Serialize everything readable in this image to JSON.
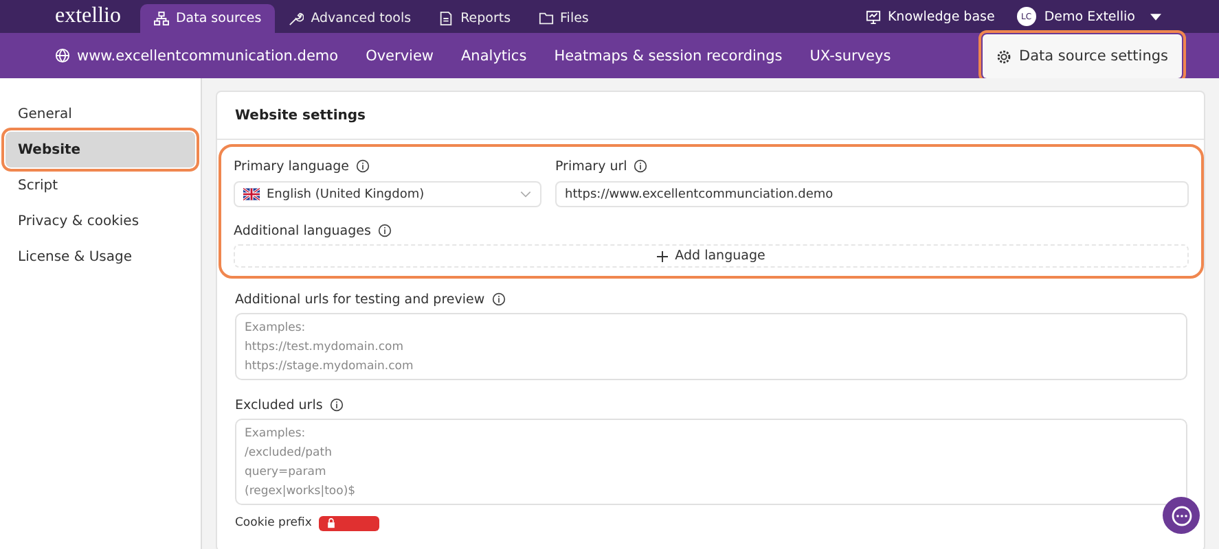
{
  "top_bar": {
    "logo": "extellio",
    "tabs": [
      {
        "label": "Data sources",
        "kind": "sitemap",
        "selected": true
      },
      {
        "label": "Advanced tools",
        "kind": "wrench",
        "selected": false
      },
      {
        "label": "Reports",
        "kind": "doc",
        "selected": false
      },
      {
        "label": "Files",
        "kind": "folder",
        "selected": false
      }
    ],
    "knowledge_base": "Knowledge base",
    "user": {
      "initials": "LC",
      "name": "Demo Extellio"
    }
  },
  "sub_bar": {
    "site": "www.excellentcommunication.demo",
    "links": [
      "Overview",
      "Analytics",
      "Heatmaps & session recordings",
      "UX-surveys"
    ],
    "settings_button": {
      "label": "Data source settings",
      "highlighted": true
    }
  },
  "sidebar": {
    "items": [
      {
        "label": "General",
        "selected": false,
        "highlighted": false
      },
      {
        "label": "Website",
        "selected": true,
        "highlighted": true
      },
      {
        "label": "Script",
        "selected": false,
        "highlighted": false
      },
      {
        "label": "Privacy & cookies",
        "selected": false,
        "highlighted": false
      },
      {
        "label": "License & Usage",
        "selected": false,
        "highlighted": false
      }
    ]
  },
  "settings": {
    "title": "Website settings",
    "language_group_highlighted": true,
    "primary_language": {
      "label": "Primary language",
      "value": "English  (United Kingdom)"
    },
    "primary_url": {
      "label": "Primary url",
      "value": "https://www.excellentcommunciation.demo"
    },
    "additional_languages": {
      "label": "Additional languages",
      "button": "Add language"
    },
    "additional_urls": {
      "label": "Additional urls for testing and preview",
      "placeholder": [
        "Examples:",
        "https://test.mydomain.com",
        "https://stage.mydomain.com"
      ]
    },
    "excluded_urls": {
      "label": "Excluded urls",
      "placeholder": [
        "Examples:",
        "/excluded/path",
        "query=param",
        "(regex|works|too)$"
      ]
    },
    "cookie_prefix": {
      "label": "Cookie prefix"
    }
  }
}
